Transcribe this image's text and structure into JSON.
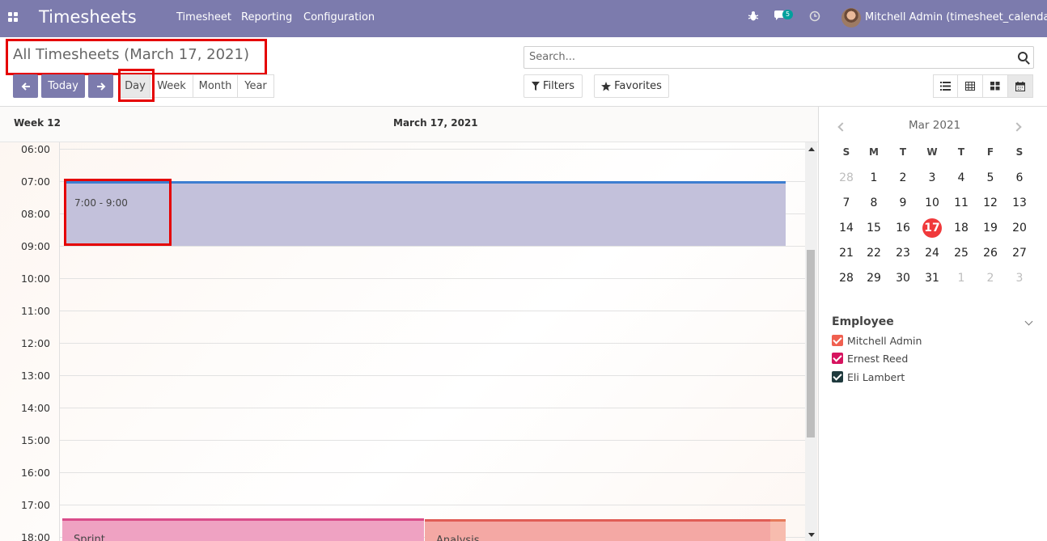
{
  "navbar": {
    "app_title": "Timesheets",
    "menu": [
      "Timesheet",
      "Reporting",
      "Configuration"
    ],
    "messages_badge": "5",
    "user": "Mitchell Admin (timesheet_calendar)",
    "icons": [
      "apps-grid-icon",
      "bug-icon",
      "chat-icon",
      "clock-icon"
    ]
  },
  "control": {
    "breadcrumb": "All Timesheets (March 17, 2021)",
    "today_label": "Today",
    "ranges": [
      "Day",
      "Week",
      "Month",
      "Year"
    ],
    "active_range": "Day",
    "search_placeholder": "Search...",
    "filters_label": "Filters",
    "favorites_label": "Favorites",
    "views": [
      "list",
      "grid",
      "kanban",
      "calendar"
    ],
    "active_view": "calendar"
  },
  "calendar": {
    "week_label": "Week 12",
    "date_label": "March 17, 2021",
    "hours": [
      "06:00",
      "07:00",
      "08:00",
      "09:00",
      "10:00",
      "11:00",
      "12:00",
      "13:00",
      "14:00",
      "15:00",
      "16:00",
      "17:00",
      "18:00"
    ],
    "events": [
      {
        "label": "7:00 - 9:00",
        "start": "07:00",
        "end": "09:00"
      },
      {
        "label": "Sprint",
        "start": "17:35"
      },
      {
        "label": "Analysis",
        "start": "17:35"
      },
      {
        "label": "",
        "start": "17:35"
      }
    ]
  },
  "mini_calendar": {
    "title": "Mar 2021",
    "weekdays": [
      "S",
      "M",
      "T",
      "W",
      "T",
      "F",
      "S"
    ],
    "weeks": [
      [
        "28",
        "1",
        "2",
        "3",
        "4",
        "5",
        "6"
      ],
      [
        "7",
        "8",
        "9",
        "10",
        "11",
        "12",
        "13"
      ],
      [
        "14",
        "15",
        "16",
        "17",
        "18",
        "19",
        "20"
      ],
      [
        "21",
        "22",
        "23",
        "24",
        "25",
        "26",
        "27"
      ],
      [
        "28",
        "29",
        "30",
        "31",
        "1",
        "2",
        "3"
      ]
    ],
    "today": "17"
  },
  "employees": {
    "title": "Employee",
    "items": [
      {
        "name": "Mitchell Admin",
        "color": "#f06050"
      },
      {
        "name": "Ernest Reed",
        "color": "#d6145f"
      },
      {
        "name": "Eli Lambert",
        "color": "#1f3a3d"
      }
    ]
  },
  "colors": {
    "brand": "#7c7bad",
    "today": "#f0393b",
    "highlight": "#e50000"
  }
}
